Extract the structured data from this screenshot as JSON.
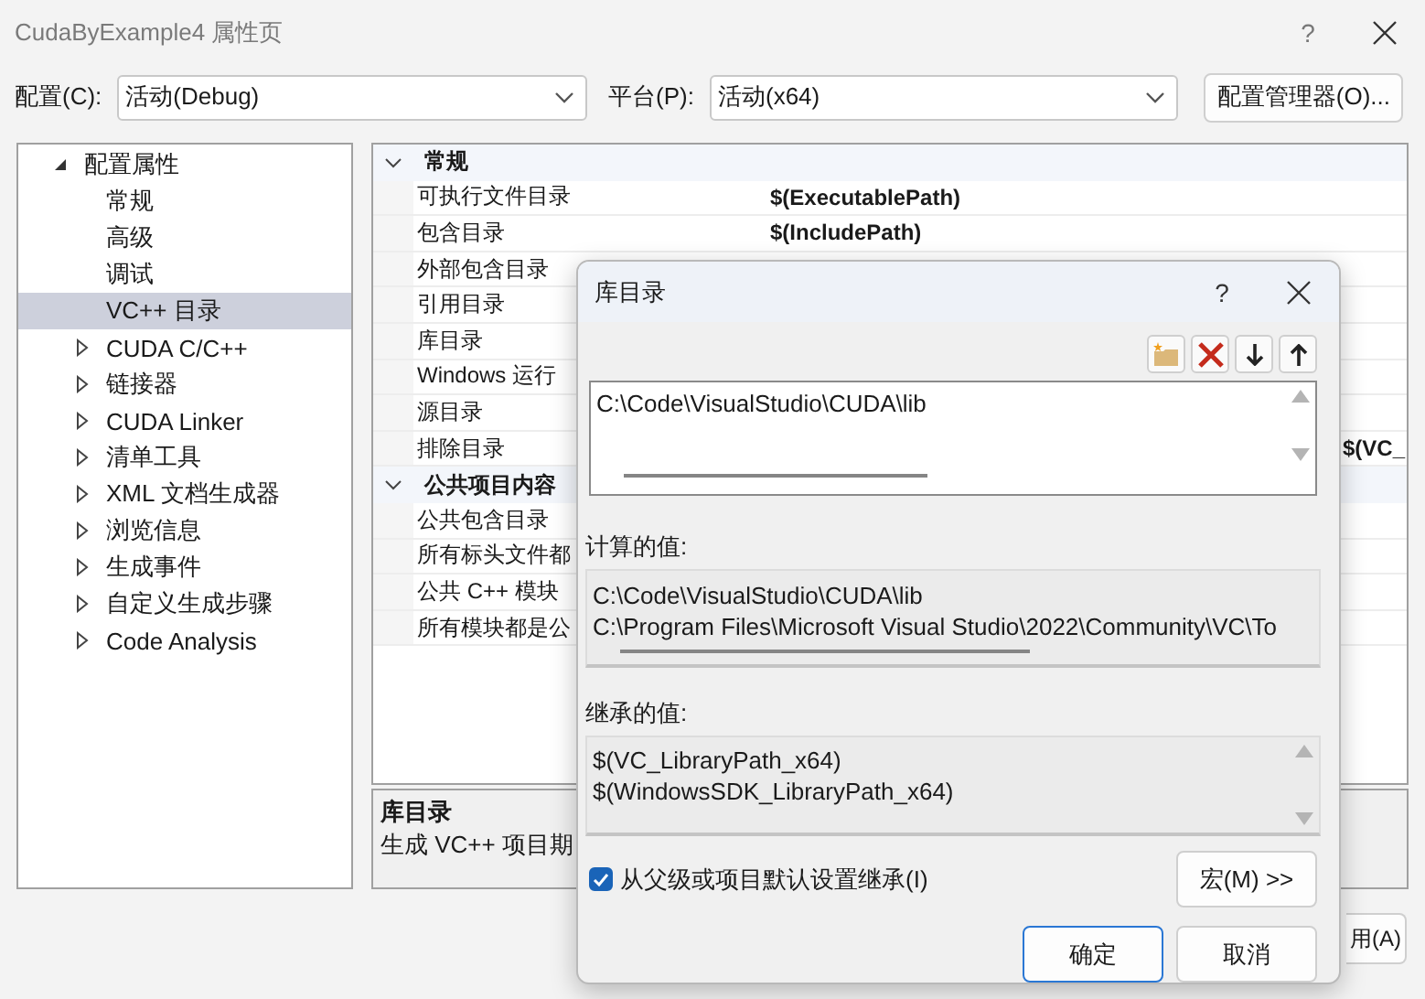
{
  "window": {
    "title": "CudaByExample4 属性页",
    "help": "?"
  },
  "toolbar": {
    "config_label": "配置(C):",
    "config_value": "活动(Debug)",
    "platform_label": "平台(P):",
    "platform_value": "活动(x64)",
    "manager_button": "配置管理器(O)..."
  },
  "tree": [
    {
      "label": "配置属性",
      "expanded": true,
      "selected": false,
      "children": [
        {
          "label": "常规",
          "selected": false
        },
        {
          "label": "高级",
          "selected": false
        },
        {
          "label": "调试",
          "selected": false
        },
        {
          "label": "VC++ 目录",
          "selected": true
        },
        {
          "label": "CUDA C/C++",
          "selected": false,
          "expanded": false
        },
        {
          "label": "链接器",
          "selected": false,
          "expanded": false
        },
        {
          "label": "CUDA Linker",
          "selected": false,
          "expanded": false
        },
        {
          "label": "清单工具",
          "selected": false,
          "expanded": false
        },
        {
          "label": "XML 文档生成器",
          "selected": false,
          "expanded": false
        },
        {
          "label": "浏览信息",
          "selected": false,
          "expanded": false
        },
        {
          "label": "生成事件",
          "selected": false,
          "expanded": false
        },
        {
          "label": "自定义生成步骤",
          "selected": false,
          "expanded": false
        },
        {
          "label": "Code Analysis",
          "selected": false,
          "expanded": false
        }
      ]
    }
  ],
  "grid": [
    {
      "name": "常规",
      "expanded": true,
      "rows": [
        {
          "name": "可执行文件目录",
          "value": "$(ExecutablePath)"
        },
        {
          "name": "包含目录",
          "value": "$(IncludePath)"
        },
        {
          "name": "外部包含目录"
        },
        {
          "name": "引用目录"
        },
        {
          "name": "库目录"
        },
        {
          "name": "Windows 运行"
        },
        {
          "name": "源目录"
        },
        {
          "name": "排除目录",
          "value_tail": "$(VC_"
        }
      ]
    },
    {
      "name": "公共项目内容",
      "expanded": true,
      "rows": [
        {
          "name": "公共包含目录"
        },
        {
          "name": "所有标头文件都"
        },
        {
          "name": "公共 C++ 模块"
        },
        {
          "name": "所有模块都是公"
        }
      ]
    }
  ],
  "description": {
    "title": "库目录",
    "text": "生成 VC++ 项目期"
  },
  "bottom_buttons": [
    "用(A)"
  ],
  "dialog": {
    "title": "库目录",
    "help": "?",
    "entries": [
      "C:\\Code\\VisualStudio\\CUDA\\lib"
    ],
    "computed_label": "计算的值:",
    "computed": [
      "C:\\Code\\VisualStudio\\CUDA\\lib",
      "C:\\Program Files\\Microsoft Visual Studio\\2022\\Community\\VC\\To"
    ],
    "inherited_label": "继承的值:",
    "inherited": [
      "$(VC_LibraryPath_x64)",
      "$(WindowsSDK_LibraryPath_x64)"
    ],
    "inherit": {
      "label": "从父级或项目默认设置继承(I)",
      "checked": true
    },
    "macro_button": "宏(M) >>",
    "ok_button": "确定",
    "cancel_button": "取消"
  }
}
